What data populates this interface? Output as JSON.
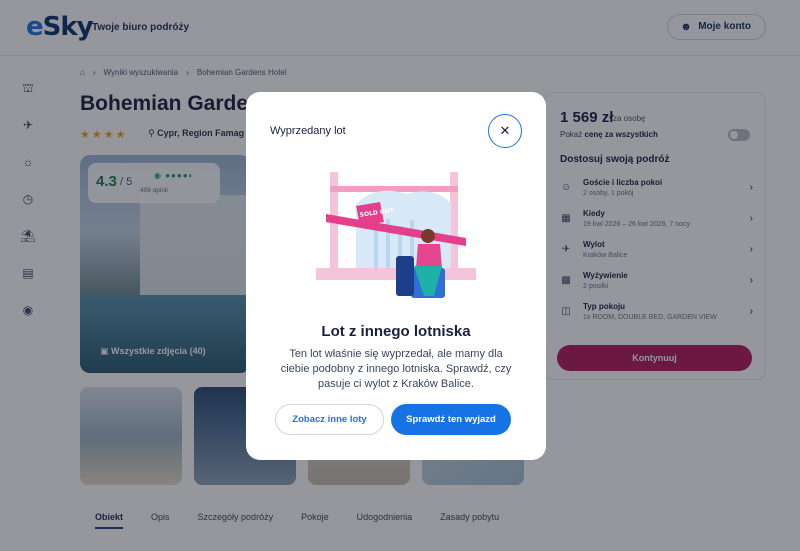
{
  "header": {
    "logo": "eSky",
    "tagline": "Twoje biuro podróży",
    "account_label": "Moje konto"
  },
  "sidebar": {
    "icons": [
      "flight-hotel-icon",
      "flight-icon",
      "hotel-icon",
      "last-minute-icon",
      "beach-icon",
      "bed-icon",
      "cruise-icon"
    ]
  },
  "breadcrumb": {
    "items": [
      "Wyniki wyszukiwania",
      "Bohemian Gardens Hotel"
    ]
  },
  "hotel": {
    "title": "Bohemian Gardens",
    "stars": 4,
    "location": "Cypr, Region Famag",
    "rating": "4.3",
    "rating_max": "/ 5",
    "reviews": "409 opinii",
    "all_photos_label": "Wszystkie zdjęcia (40)"
  },
  "tabs": [
    "Obiekt",
    "Opis",
    "Szczegóły podróży",
    "Pokoje",
    "Udogodnienia",
    "Zasady pobytu"
  ],
  "panel": {
    "price": "1 569 zł",
    "price_note": "za osobę",
    "toggle_prefix": "Pokaż",
    "toggle_bold": "cenę za wszystkich",
    "adjust_title": "Dostosuj swoją podróż",
    "rows": [
      {
        "label": "Goście i liczba pokoi",
        "value": "2 osoby, 1 pokój",
        "icon": "guests-icon"
      },
      {
        "label": "Kiedy",
        "value": "19 kwi 2026 – 26 kwi 2026, 7 nocy",
        "icon": "calendar-icon"
      },
      {
        "label": "Wylot",
        "value": "Kraków Balice",
        "icon": "departure-icon"
      },
      {
        "label": "Wyżywienie",
        "value": "2 posiłki",
        "icon": "meal-icon"
      },
      {
        "label": "Typ pokoju",
        "value": "1x ROOM, DOUBLE BED, GARDEN VIEW",
        "icon": "room-icon"
      }
    ],
    "continue_label": "Kontynuuj"
  },
  "modal": {
    "header": "Wyprzedany lot",
    "sold_out": "SOLD OUT",
    "title": "Lot z innego lotniska",
    "body": "Ten lot właśnie się wyprzedał, ale mamy dla ciebie podobny z innego lotniska. Sprawdź, czy pasuje ci wylot z Kraków Balice.",
    "secondary_label": "Zobacz inne loty",
    "primary_label": "Sprawdź ten wyjazd"
  }
}
